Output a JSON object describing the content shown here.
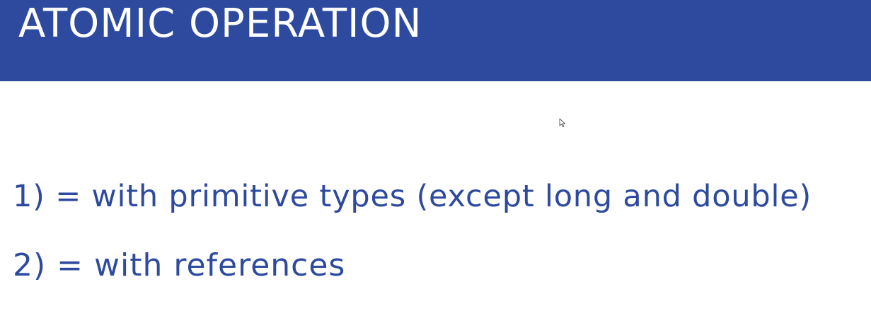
{
  "slide": {
    "title": "ATOMIC OPERATION",
    "points": [
      "1) = with primitive types (except long and double)",
      "2) = with references"
    ]
  },
  "colors": {
    "title_bar": "#2d4a9e",
    "title_text": "#ffffff",
    "body_text": "#2d4a9e"
  },
  "icons": {
    "cursor": "mouse-pointer-icon"
  }
}
